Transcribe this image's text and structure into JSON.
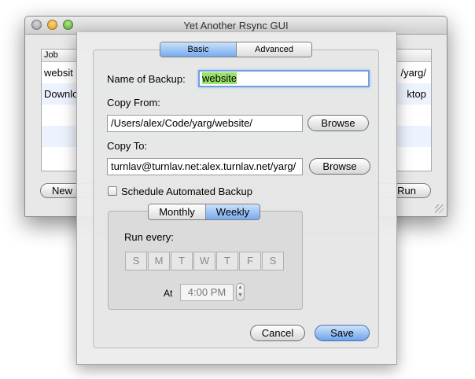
{
  "background_window": {
    "title": "Yet Another Rsync GUI",
    "table_header": "Job",
    "rows": [
      {
        "left": "websit",
        "right": "/yarg/"
      },
      {
        "left": "Downlo",
        "right": "ktop"
      }
    ],
    "new_button": "New",
    "run_button": "Run"
  },
  "sheet": {
    "tabs": [
      "Basic",
      "Advanced"
    ],
    "selected_tab": "Basic",
    "name_label": "Name of Backup:",
    "name_value": "website",
    "copy_from_label": "Copy From:",
    "copy_from_value": "/Users/alex/Code/yarg/website/",
    "copy_to_label": "Copy To:",
    "copy_to_value": "turnlav@turnlav.net:alex.turnlav.net/yarg/",
    "browse_label": "Browse",
    "schedule_label": "Schedule Automated Backup",
    "schedule_checked": false,
    "schedule_tabs": [
      "Monthly",
      "Weekly"
    ],
    "selected_schedule_tab": "Weekly",
    "run_every_label": "Run every:",
    "days": [
      "S",
      "M",
      "T",
      "W",
      "T",
      "F",
      "S"
    ],
    "at_label": "At",
    "time_value": "4:00 PM",
    "cancel_button": "Cancel",
    "save_button": "Save"
  },
  "colors": {
    "selected_segment": "#77aaf0",
    "default_button": "#6da3ec",
    "text_selection": "#9ae06b"
  }
}
